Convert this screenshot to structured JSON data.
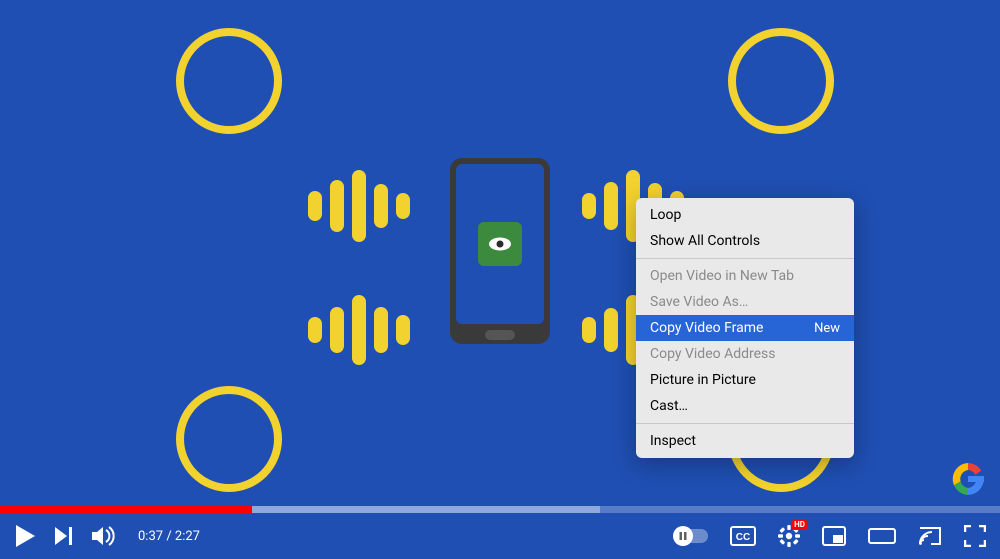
{
  "player": {
    "current_time": "0:37",
    "duration": "2:27",
    "progress_percent": 25.2,
    "hd_badge": "HD"
  },
  "context_menu": {
    "items": {
      "loop": "Loop",
      "show_all_controls": "Show All Controls",
      "open_new_tab": "Open Video in New Tab",
      "save_as": "Save Video As…",
      "copy_frame": "Copy Video Frame",
      "copy_frame_badge": "New",
      "copy_address": "Copy Video Address",
      "pip": "Picture in Picture",
      "cast": "Cast…",
      "inspect": "Inspect"
    }
  }
}
